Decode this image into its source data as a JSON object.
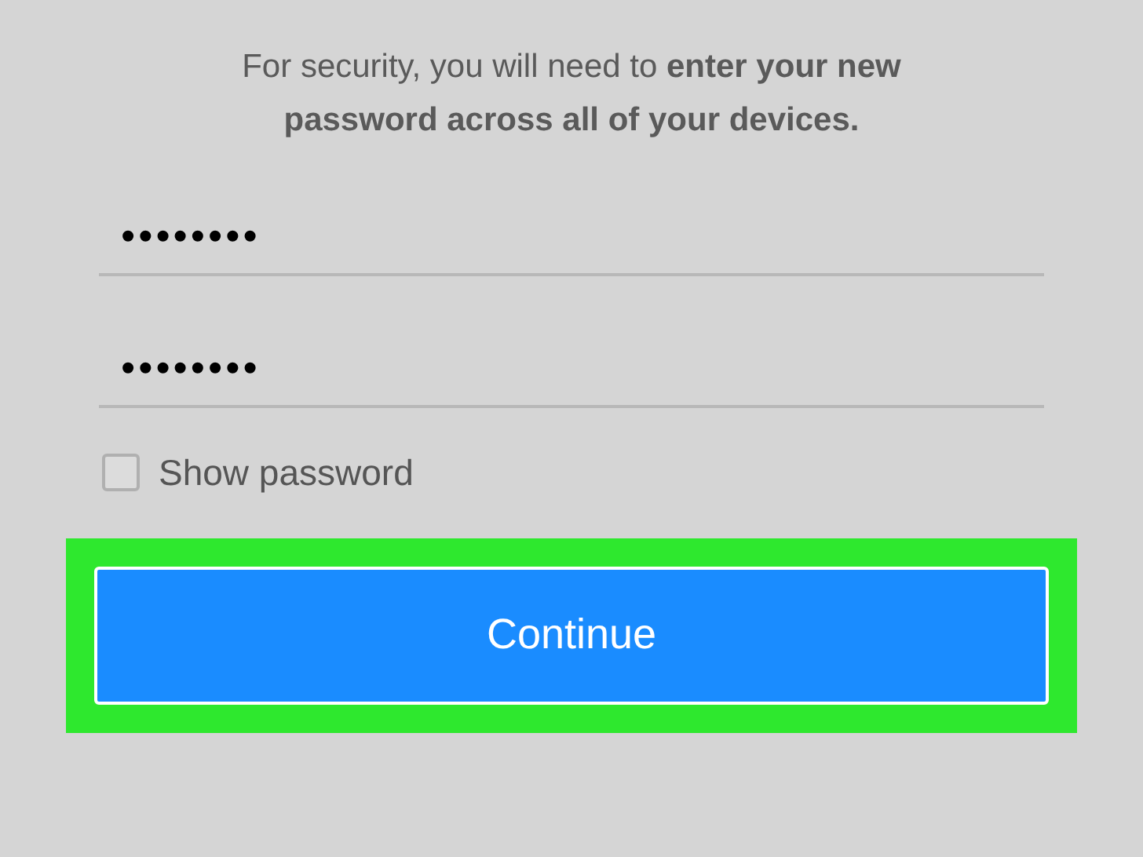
{
  "message": "For security, you will need to **enter your new password across all of your devices.**",
  "fields": [
    {
      "value": "••••••••"
    },
    {
      "value": "••••••••"
    }
  ],
  "show_password": {
    "label": "Show password",
    "checked": false
  },
  "button": {
    "label": "Continue",
    "highlighted": true
  }
}
